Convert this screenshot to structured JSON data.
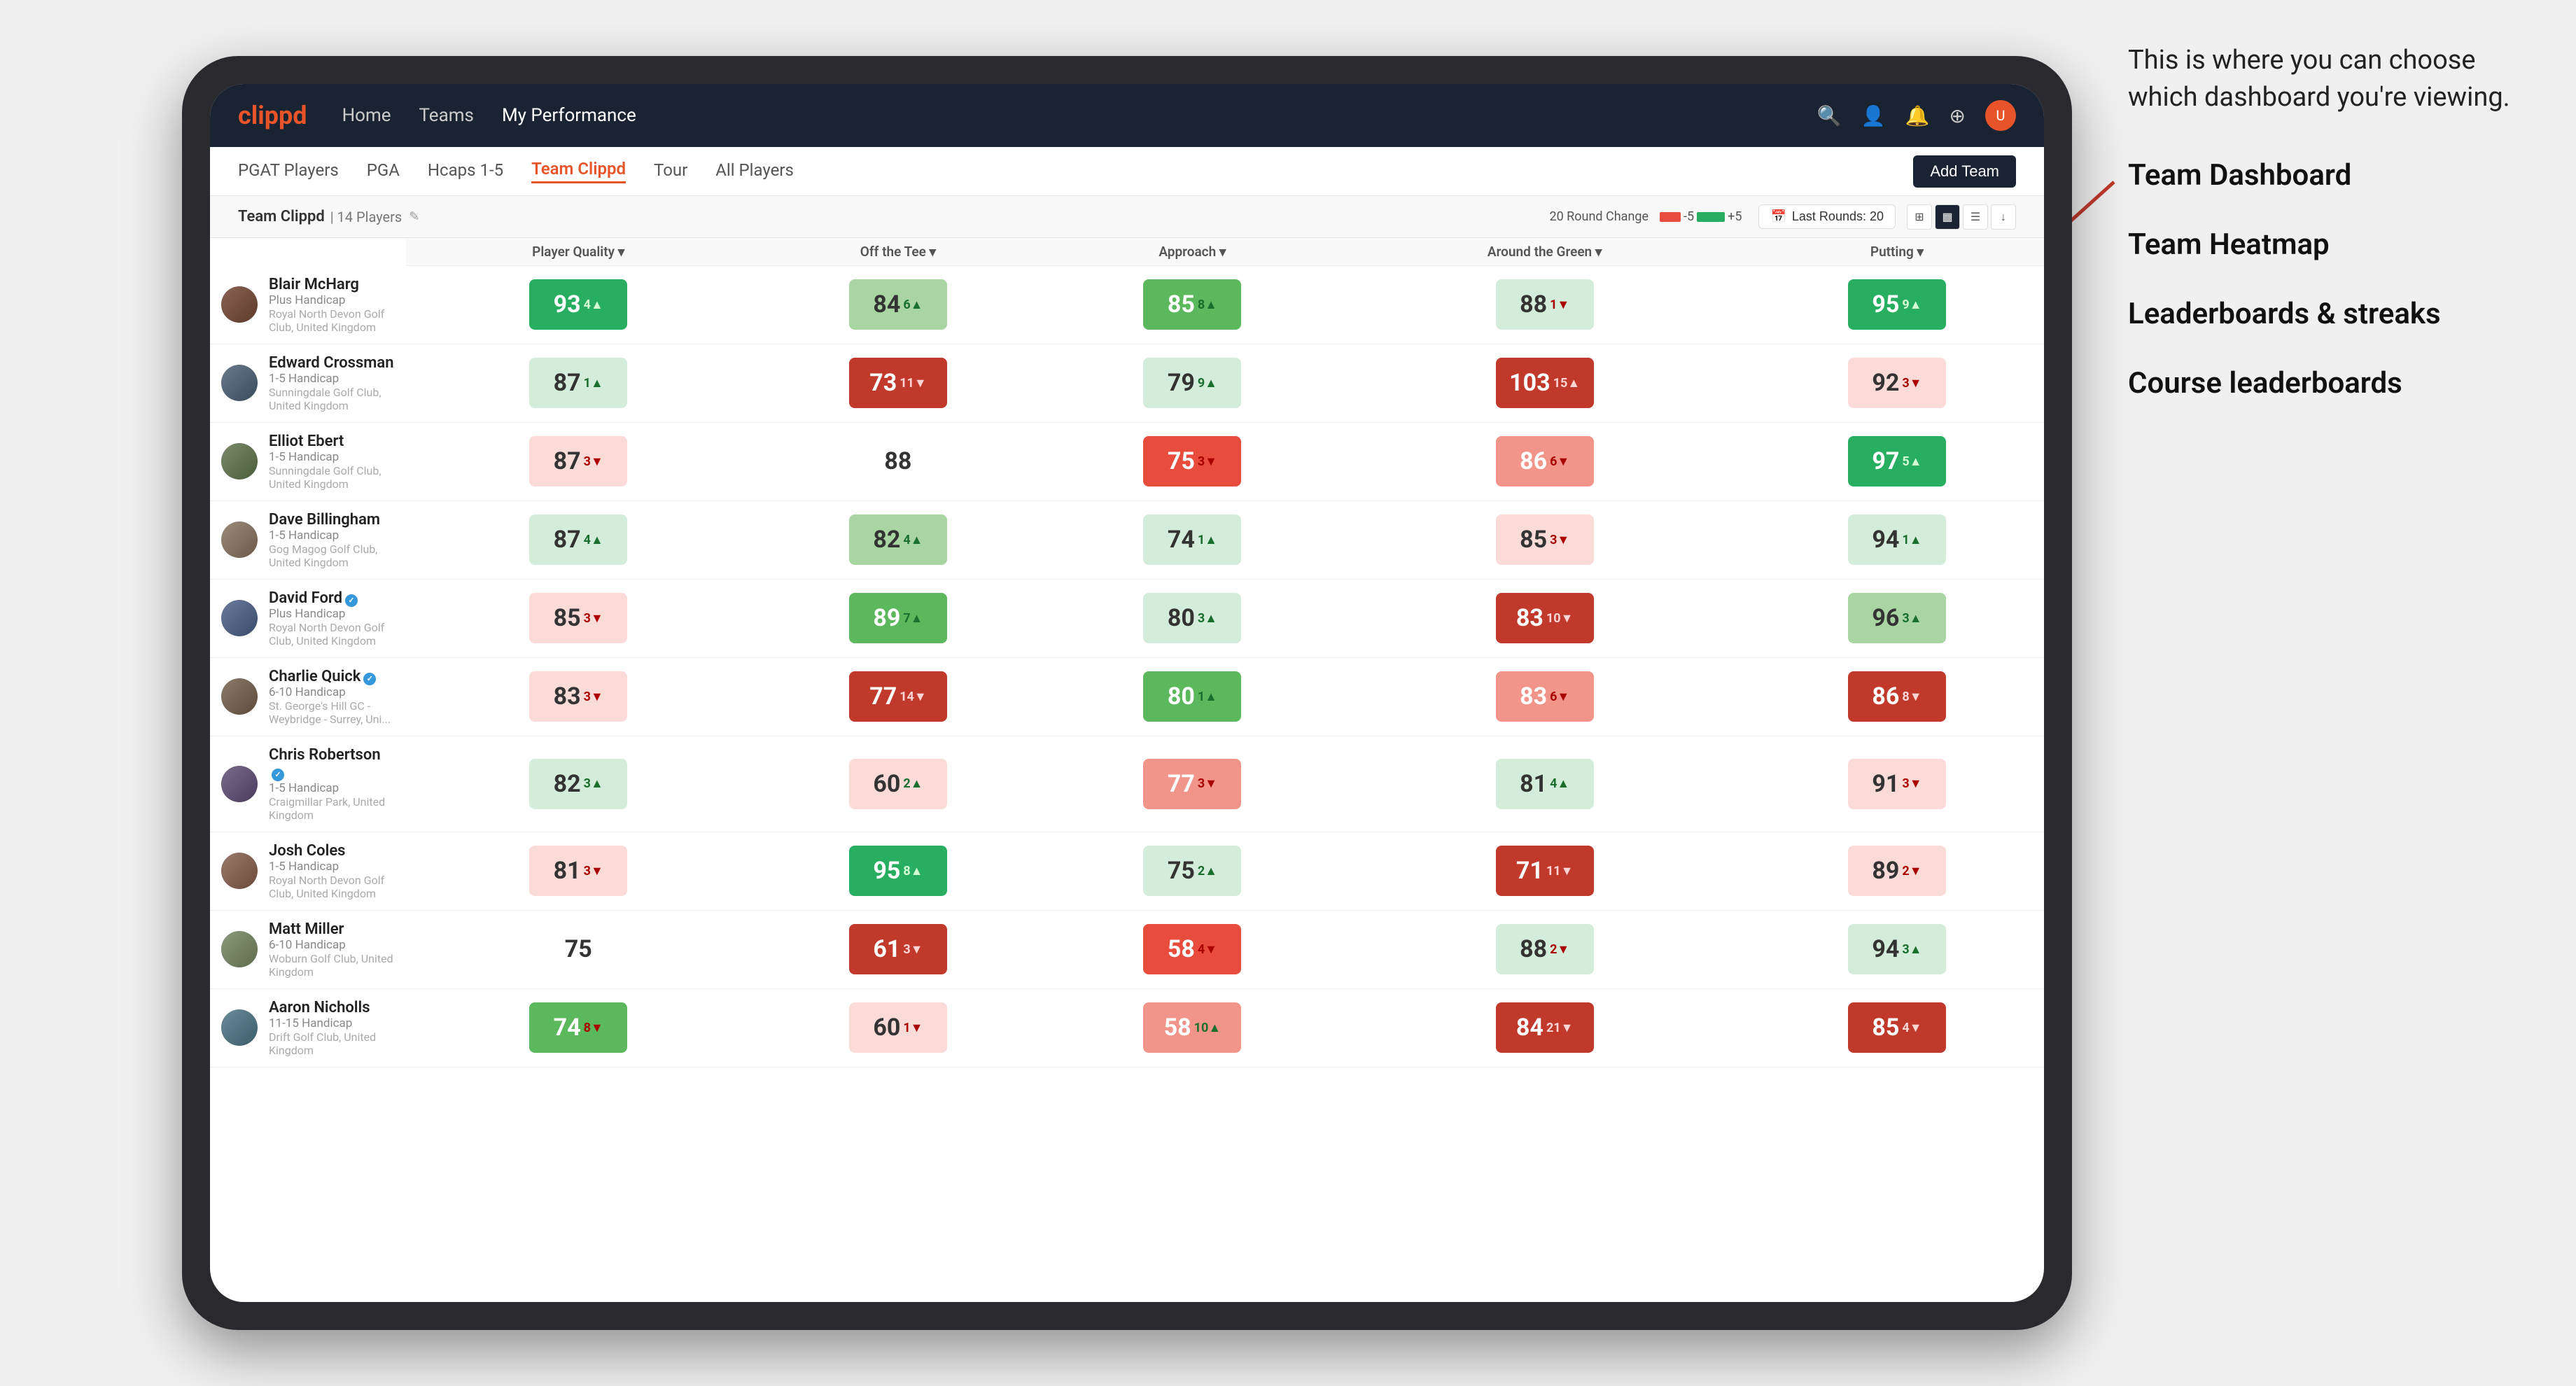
{
  "annotation": {
    "intro": "This is where you can choose which dashboard you're viewing.",
    "items": [
      "Team Dashboard",
      "Team Heatmap",
      "Leaderboards & streaks",
      "Course leaderboards"
    ]
  },
  "navbar": {
    "logo": "clippd",
    "links": [
      {
        "label": "Home",
        "active": false
      },
      {
        "label": "Teams",
        "active": false
      },
      {
        "label": "My Performance",
        "active": true
      }
    ],
    "icons": [
      "🔍",
      "👤",
      "🔔",
      "⊕"
    ]
  },
  "subnav": {
    "items": [
      {
        "label": "PGAT Players",
        "active": false
      },
      {
        "label": "PGA",
        "active": false
      },
      {
        "label": "Hcaps 1-5",
        "active": false
      },
      {
        "label": "Team Clippd",
        "active": true
      },
      {
        "label": "Tour",
        "active": false
      },
      {
        "label": "All Players",
        "active": false
      }
    ],
    "add_team_label": "Add Team"
  },
  "team_bar": {
    "name": "Team Clippd",
    "separator": "|",
    "count": "14 Players",
    "round_change_label": "20 Round Change",
    "round_change_neg": "-5",
    "round_change_pos": "+5",
    "last_rounds_label": "Last Rounds:",
    "last_rounds_value": "20"
  },
  "table": {
    "columns": {
      "player_quality": "Player Quality ▾",
      "off_tee": "Off the Tee ▾",
      "approach": "Approach ▾",
      "around_green": "Around the Green ▾",
      "putting": "Putting ▾"
    },
    "players": [
      {
        "name": "Blair McHarg",
        "handicap": "Plus Handicap",
        "club": "Royal North Devon Golf Club, United Kingdom",
        "verified": false,
        "scores": [
          {
            "value": 93,
            "change": 4,
            "dir": "up",
            "color": "bg-green-dark"
          },
          {
            "value": 84,
            "change": 6,
            "dir": "up",
            "color": "bg-green-light"
          },
          {
            "value": 85,
            "change": 8,
            "dir": "up",
            "color": "bg-green-med"
          },
          {
            "value": 88,
            "change": 1,
            "dir": "down",
            "color": "bg-green-pale"
          },
          {
            "value": 95,
            "change": 9,
            "dir": "up",
            "color": "bg-green-dark"
          }
        ]
      },
      {
        "name": "Edward Crossman",
        "handicap": "1-5 Handicap",
        "club": "Sunningdale Golf Club, United Kingdom",
        "verified": false,
        "scores": [
          {
            "value": 87,
            "change": 1,
            "dir": "up",
            "color": "bg-green-pale"
          },
          {
            "value": 73,
            "change": 11,
            "dir": "down",
            "color": "bg-red-dark"
          },
          {
            "value": 79,
            "change": 9,
            "dir": "up",
            "color": "bg-green-pale"
          },
          {
            "value": 103,
            "change": 15,
            "dir": "up",
            "color": "bg-red-dark"
          },
          {
            "value": 92,
            "change": 3,
            "dir": "down",
            "color": "bg-red-pale"
          }
        ]
      },
      {
        "name": "Elliot Ebert",
        "handicap": "1-5 Handicap",
        "club": "Sunningdale Golf Club, United Kingdom",
        "verified": false,
        "scores": [
          {
            "value": 87,
            "change": 3,
            "dir": "down",
            "color": "bg-red-pale"
          },
          {
            "value": 88,
            "change": null,
            "dir": null,
            "color": "bg-white"
          },
          {
            "value": 75,
            "change": 3,
            "dir": "down",
            "color": "bg-red-med"
          },
          {
            "value": 86,
            "change": 6,
            "dir": "down",
            "color": "bg-red-light"
          },
          {
            "value": 97,
            "change": 5,
            "dir": "up",
            "color": "bg-green-dark"
          }
        ]
      },
      {
        "name": "Dave Billingham",
        "handicap": "1-5 Handicap",
        "club": "Gog Magog Golf Club, United Kingdom",
        "verified": false,
        "scores": [
          {
            "value": 87,
            "change": 4,
            "dir": "up",
            "color": "bg-green-pale"
          },
          {
            "value": 82,
            "change": 4,
            "dir": "up",
            "color": "bg-green-light"
          },
          {
            "value": 74,
            "change": 1,
            "dir": "up",
            "color": "bg-green-pale"
          },
          {
            "value": 85,
            "change": 3,
            "dir": "down",
            "color": "bg-red-pale"
          },
          {
            "value": 94,
            "change": 1,
            "dir": "up",
            "color": "bg-green-pale"
          }
        ]
      },
      {
        "name": "David Ford",
        "handicap": "Plus Handicap",
        "club": "Royal North Devon Golf Club, United Kingdom",
        "verified": true,
        "scores": [
          {
            "value": 85,
            "change": 3,
            "dir": "down",
            "color": "bg-red-pale"
          },
          {
            "value": 89,
            "change": 7,
            "dir": "up",
            "color": "bg-green-med"
          },
          {
            "value": 80,
            "change": 3,
            "dir": "up",
            "color": "bg-green-pale"
          },
          {
            "value": 83,
            "change": 10,
            "dir": "down",
            "color": "bg-red-dark"
          },
          {
            "value": 96,
            "change": 3,
            "dir": "up",
            "color": "bg-green-light"
          }
        ]
      },
      {
        "name": "Charlie Quick",
        "handicap": "6-10 Handicap",
        "club": "St. George's Hill GC - Weybridge - Surrey, Uni...",
        "verified": true,
        "scores": [
          {
            "value": 83,
            "change": 3,
            "dir": "down",
            "color": "bg-red-pale"
          },
          {
            "value": 77,
            "change": 14,
            "dir": "down",
            "color": "bg-red-dark"
          },
          {
            "value": 80,
            "change": 1,
            "dir": "up",
            "color": "bg-green-med"
          },
          {
            "value": 83,
            "change": 6,
            "dir": "down",
            "color": "bg-red-light"
          },
          {
            "value": 86,
            "change": 8,
            "dir": "down",
            "color": "bg-red-dark"
          }
        ]
      },
      {
        "name": "Chris Robertson",
        "handicap": "1-5 Handicap",
        "club": "Craigmillar Park, United Kingdom",
        "verified": true,
        "scores": [
          {
            "value": 82,
            "change": 3,
            "dir": "up",
            "color": "bg-green-pale"
          },
          {
            "value": 60,
            "change": 2,
            "dir": "up",
            "color": "bg-red-pale"
          },
          {
            "value": 77,
            "change": 3,
            "dir": "down",
            "color": "bg-red-light"
          },
          {
            "value": 81,
            "change": 4,
            "dir": "up",
            "color": "bg-green-pale"
          },
          {
            "value": 91,
            "change": 3,
            "dir": "down",
            "color": "bg-red-pale"
          }
        ]
      },
      {
        "name": "Josh Coles",
        "handicap": "1-5 Handicap",
        "club": "Royal North Devon Golf Club, United Kingdom",
        "verified": false,
        "scores": [
          {
            "value": 81,
            "change": 3,
            "dir": "down",
            "color": "bg-red-pale"
          },
          {
            "value": 95,
            "change": 8,
            "dir": "up",
            "color": "bg-green-dark"
          },
          {
            "value": 75,
            "change": 2,
            "dir": "up",
            "color": "bg-green-pale"
          },
          {
            "value": 71,
            "change": 11,
            "dir": "down",
            "color": "bg-red-dark"
          },
          {
            "value": 89,
            "change": 2,
            "dir": "down",
            "color": "bg-red-pale"
          }
        ]
      },
      {
        "name": "Matt Miller",
        "handicap": "6-10 Handicap",
        "club": "Woburn Golf Club, United Kingdom",
        "verified": false,
        "scores": [
          {
            "value": 75,
            "change": null,
            "dir": null,
            "color": "bg-white"
          },
          {
            "value": 61,
            "change": 3,
            "dir": "down",
            "color": "bg-red-dark"
          },
          {
            "value": 58,
            "change": 4,
            "dir": "down",
            "color": "bg-red-med"
          },
          {
            "value": 88,
            "change": 2,
            "dir": "down",
            "color": "bg-green-pale"
          },
          {
            "value": 94,
            "change": 3,
            "dir": "up",
            "color": "bg-green-pale"
          }
        ]
      },
      {
        "name": "Aaron Nicholls",
        "handicap": "11-15 Handicap",
        "club": "Drift Golf Club, United Kingdom",
        "verified": false,
        "scores": [
          {
            "value": 74,
            "change": 8,
            "dir": "down",
            "color": "bg-green-med"
          },
          {
            "value": 60,
            "change": 1,
            "dir": "down",
            "color": "bg-red-pale"
          },
          {
            "value": 58,
            "change": 10,
            "dir": "up",
            "color": "bg-red-light"
          },
          {
            "value": 84,
            "change": 21,
            "dir": "down",
            "color": "bg-red-dark"
          },
          {
            "value": 85,
            "change": 4,
            "dir": "down",
            "color": "bg-red-dark"
          }
        ]
      }
    ]
  }
}
